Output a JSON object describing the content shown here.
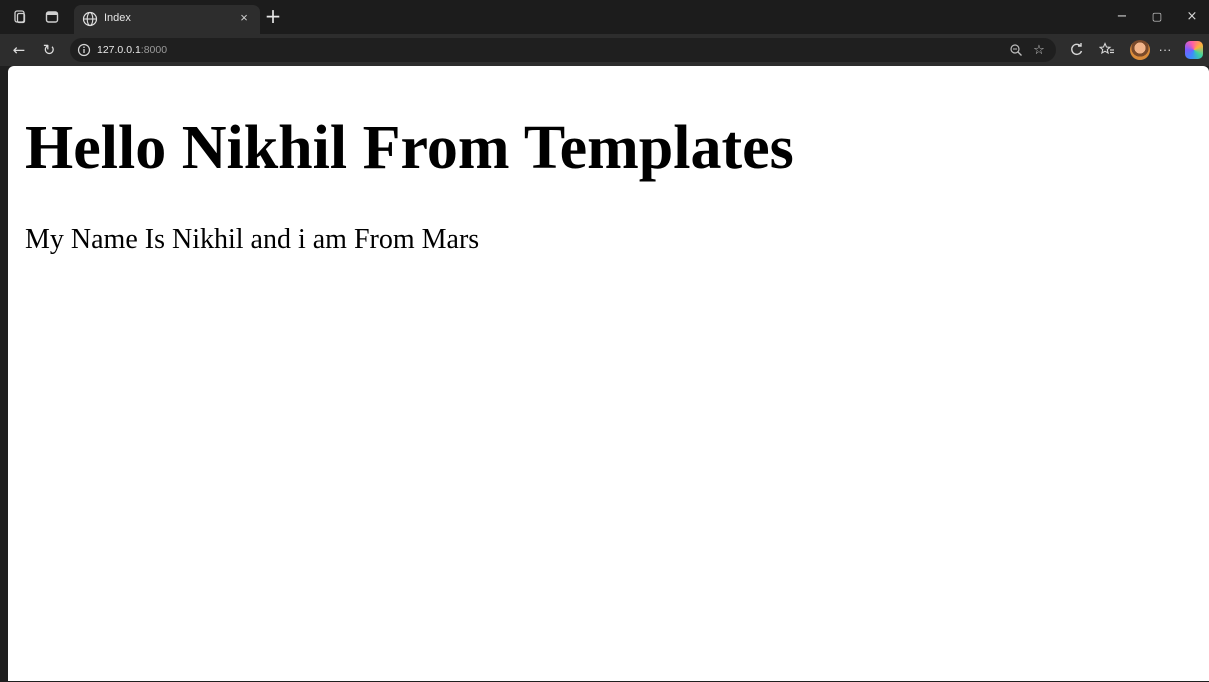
{
  "browser": {
    "tab": {
      "title": "Index",
      "close_glyph": "×",
      "icon": "globe-icon"
    },
    "new_tab_glyph": "+",
    "window_controls": {
      "minimize": "−",
      "maximize": "▢",
      "close": "×"
    },
    "nav": {
      "back": "←",
      "refresh": "↻"
    },
    "address_bar": {
      "host": "127.0.0.1",
      "port": ":8000",
      "icon": "info-icon"
    },
    "toolbar_glyphs": {
      "extensions": "↻",
      "favorites": "☆",
      "more": "···"
    }
  },
  "page": {
    "heading": "Hello Nikhil From Templates",
    "paragraph": "My Name Is Nikhil and i am From Mars"
  }
}
